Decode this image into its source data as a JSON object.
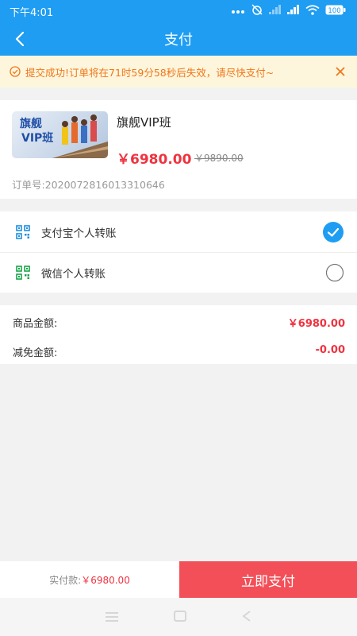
{
  "status_bar": {
    "time": "下午4:01",
    "battery": "100"
  },
  "nav": {
    "title": "支付"
  },
  "notice": {
    "text": "提交成功!订单将在71时59分58秒后失效，请尽快支付~"
  },
  "product": {
    "thumb_line1": "旗舰",
    "thumb_line2": "VIP班",
    "title": "旗舰VIP班",
    "price": "￥6980.00",
    "original_price": "￥9890.00",
    "order_number": "订单号:2020072816013310646"
  },
  "payment_methods": [
    {
      "label": "支付宝个人转账",
      "selected": true
    },
    {
      "label": "微信个人转账",
      "selected": false
    }
  ],
  "amounts": [
    {
      "label": "商品金额:",
      "value": "￥6980.00"
    },
    {
      "label": "减免金额:",
      "value": "-0.00"
    }
  ],
  "bottom_bar": {
    "total_prefix": "实付款:",
    "total_amount": "￥6980.00",
    "pay_button": "立即支付"
  },
  "colors": {
    "header": "#1e9df2",
    "accent_red": "#f0333f",
    "pay_button": "#f34f58",
    "notice_bg": "#fdf6dc",
    "notice_text": "#f0761b",
    "alipay_icon": "#1e8fe0",
    "wechat_icon": "#1aa34a"
  }
}
